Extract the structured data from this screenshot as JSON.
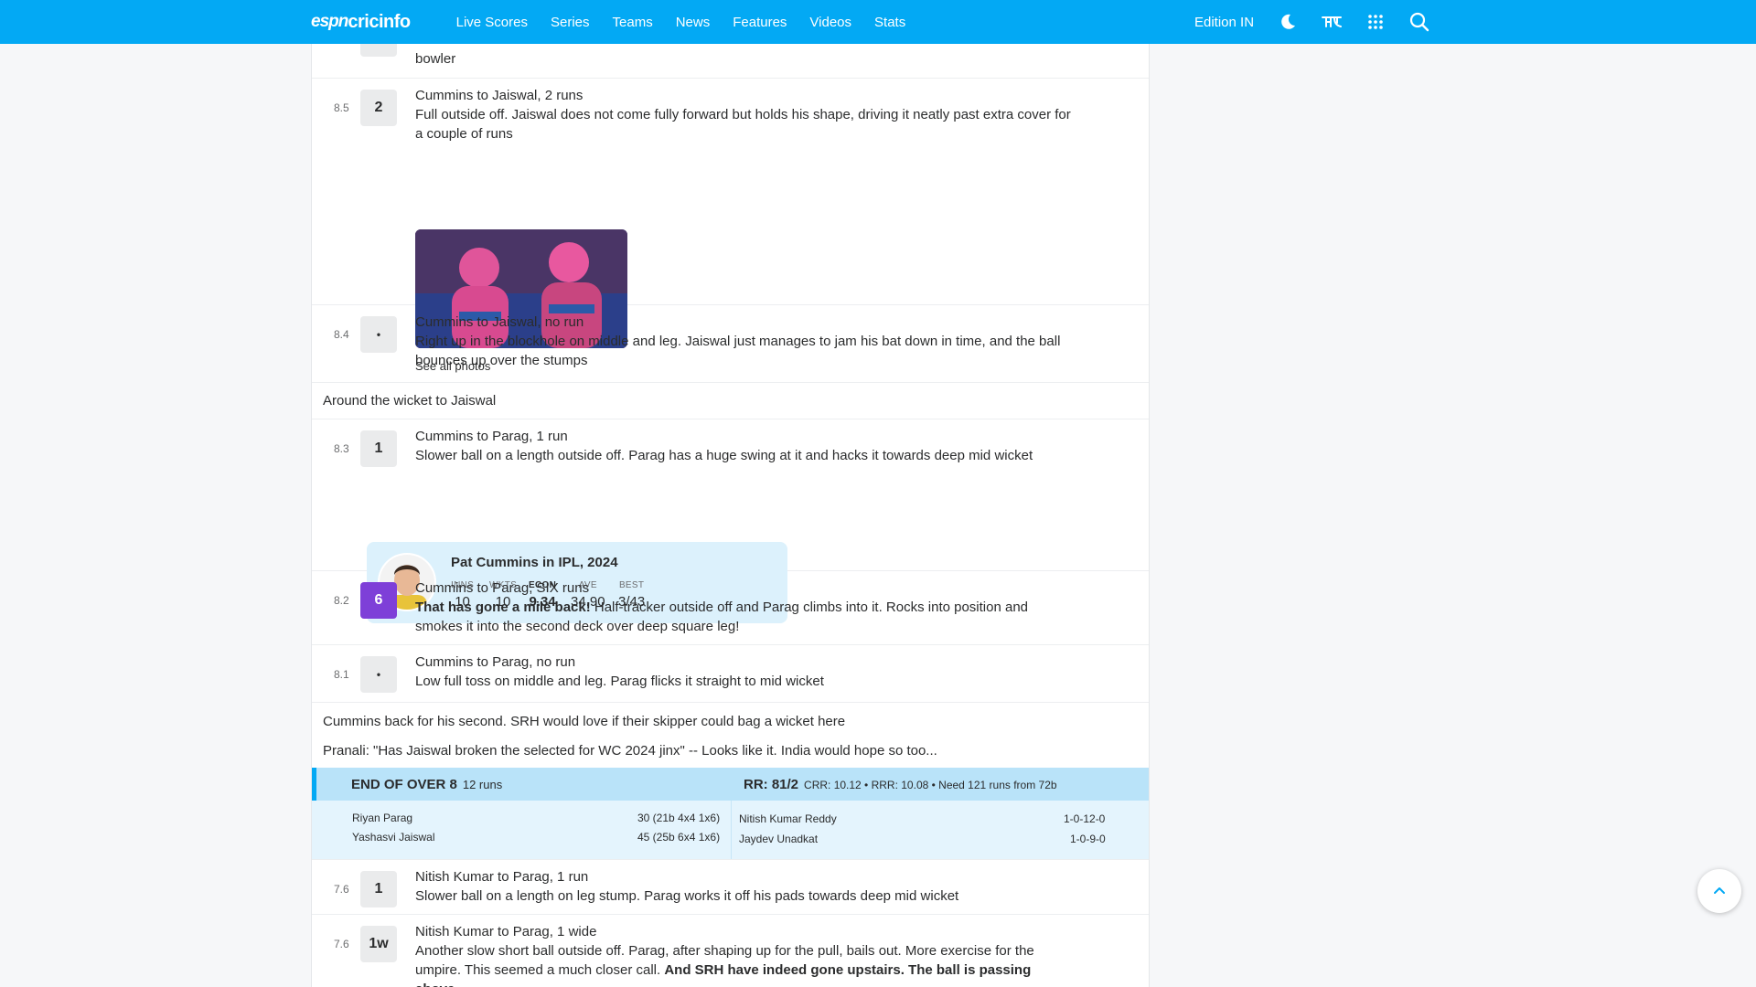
{
  "nav": {
    "logo_espn": "espn",
    "logo_cric": "cricinfo",
    "links": [
      "Live Scores",
      "Series",
      "Teams",
      "News",
      "Features",
      "Videos",
      "Stats"
    ],
    "edition": "Edition IN",
    "icons": [
      "moon-icon",
      "language-icon",
      "apps-grid-icon",
      "search-icon"
    ],
    "brand_color": "#03a9f4"
  },
  "commentary": {
    "top_partial": "bowler",
    "balls": [
      {
        "over": "8.5",
        "runs": "2",
        "title": "Cummins to Jaiswal, 2 runs",
        "text": "Full outside off. Jaiswal does not come fully forward but holds his shape, driving it neatly past extra cover for a couple of runs",
        "see_photos": "See all photos"
      },
      {
        "over": "8.4",
        "runs": "•",
        "title": "Cummins to Jaiswal, no run",
        "text": "Right up in the blockhole on middle and leg. Jaiswal just manages to jam his bat down in time, and the ball bounces up over the stumps"
      },
      {
        "over": "8.3",
        "runs": "1",
        "title": "Cummins to Parag, 1 run",
        "text": "Slower ball on a length outside off. Parag has a huge swing at it and hacks it towards deep mid wicket"
      },
      {
        "over": "8.2",
        "runs": "6",
        "title": "Cummins to Parag, SIX runs",
        "text_bold": "That has gone a mile back!",
        "text": " Half-tracker outside off and Parag climbs into it. Rocks into position and smokes it into the second deck over deep square leg!"
      },
      {
        "over": "8.1",
        "runs": "•",
        "title": "Cummins to Parag, no run",
        "text": "Low full toss on middle and leg. Parag flicks it straight to mid wicket"
      },
      {
        "over": "7.6",
        "runs": "1",
        "title": "Nitish Kumar to Parag, 1 run",
        "text": "Slower ball on a length on leg stump. Parag works it off his pads towards deep mid wicket"
      },
      {
        "over": "7.6",
        "runs": "1w",
        "title": "Nitish Kumar to Parag, 1 wide",
        "text": "Another slow short ball outside off. Parag, after shaping up for the pull, bails out. More exercise for the umpire. This seemed a much closer call. ",
        "text_bold": "And SRH have indeed gone upstairs. The ball is passing above"
      }
    ],
    "notes": {
      "around_wicket": "Around the wicket to Jaiswal",
      "cummins_back": "Cummins back for his second. SRH would love if their skipper could bag a wicket here",
      "pranali": "Pranali: \"Has Jaiswal broken the selected for WC 2024 jinx\" -- Looks like it. India would hope so too..."
    },
    "player_card": {
      "title": "Pat Cummins in IPL, 2024",
      "stats": [
        {
          "label": "INNS",
          "value": "10"
        },
        {
          "label": "WKTS",
          "value": "10"
        },
        {
          "label": "ECON",
          "value": "9.34"
        },
        {
          "label": "AVE",
          "value": "34.90"
        },
        {
          "label": "BEST",
          "value": "3/43"
        }
      ]
    },
    "end_of_over": {
      "title": "END OF OVER 8",
      "runs": "12 runs",
      "score": "RR: 81/2",
      "rates": "CRR: 10.12 • RRR: 10.08 • Need 121 runs from 72b",
      "batters": [
        {
          "name": "Riyan Parag",
          "figures": "30 (21b 4x4 1x6)"
        },
        {
          "name": "Yashasvi Jaiswal",
          "figures": "45 (25b 6x4 1x6)"
        }
      ],
      "bowlers": [
        {
          "name": "Nitish Kumar Reddy",
          "figures": "1-0-12-0"
        },
        {
          "name": "Jaydev Unadkat",
          "figures": "1-0-9-0"
        }
      ]
    }
  }
}
